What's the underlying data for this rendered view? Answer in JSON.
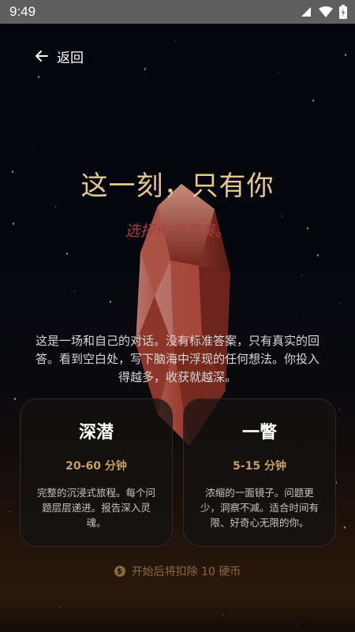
{
  "status_bar": {
    "time": "9:49"
  },
  "nav": {
    "back_label": "返回"
  },
  "hero": {
    "title": "这一刻，只有你",
    "subtitle": "选择你的节奏。",
    "intro_line1": "这是一场和自己的对话。没有标准答案，只有真实的回",
    "intro_line2": "答。看到空白处，写下脑海中浮现的任何想法。你投入",
    "intro_line3": "得越多，收获就越深。"
  },
  "modes": [
    {
      "title": "深潜",
      "duration": "20-60 分钟",
      "desc_line1": "完整的沉浸式旅程。每个问",
      "desc_line2": "题层层递进。报告深入灵",
      "desc_line3": "魂。"
    },
    {
      "title": "一瞥",
      "duration": "5-15 分钟",
      "desc_line1": "浓缩的一面镜子。问题更",
      "desc_line2": "少，洞察不减。适合时间有",
      "desc_line3": "限、好奇心无限的你。"
    }
  ],
  "cost": {
    "text": "开始后将扣除 10 硬币",
    "icon": "coin-icon"
  },
  "colors": {
    "accent_gold": "#e6c88d",
    "subtitle_red": "#a8423e",
    "duration_gold": "#c7a062"
  }
}
